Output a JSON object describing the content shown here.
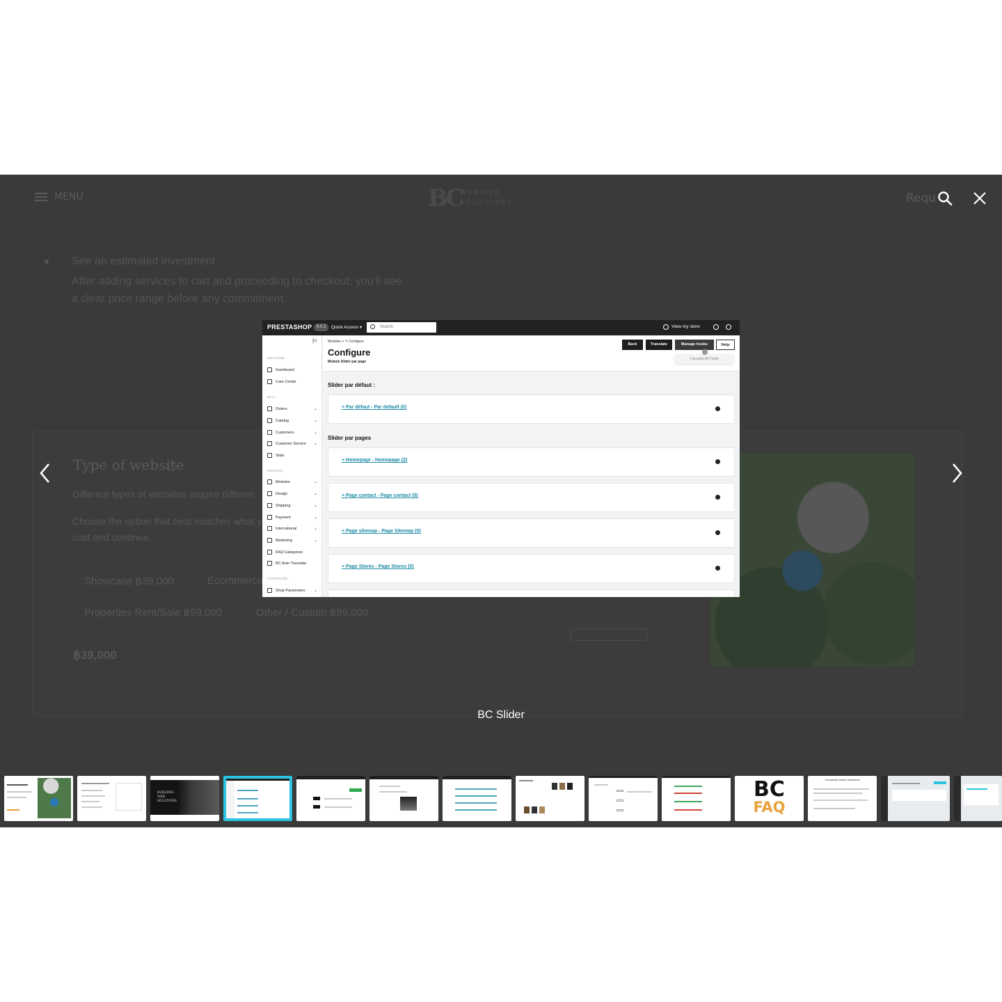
{
  "site_header": {
    "menu_label": "MENU",
    "logo_mark": "BC",
    "logo_text_line1": "WEBSITE",
    "logo_text_line2": "SOLUTIONS",
    "request_label": "Requ"
  },
  "background_page": {
    "bullet_title": "See an estimated investment",
    "bullet_body_line1": "After adding services to cart and proceeding to checkout, you'll see",
    "bullet_body_line2": "a clear price range before any commitment.",
    "type_title": "Type of website",
    "info_glyph": "i",
    "desc_line1": "Different types of websites require differen",
    "desc_line2": "Choose the option that best matches what y",
    "desc_line3": "cost and continue.",
    "options": [
      "Showcase ฿39,000",
      "Ecommerce",
      "Properties Rent/Sale ฿59,000",
      "Other / Custom ฿99,000"
    ],
    "total": "฿39,000"
  },
  "lightbox": {
    "caption": "BC Slider",
    "controls": {
      "search_icon": "search-icon",
      "close_icon": "close-icon",
      "prev_icon": "chevron-left-icon",
      "next_icon": "chevron-right-icon"
    },
    "accent_color": "#2bc3e0"
  },
  "screenshot": {
    "topbar": {
      "logo": "PRESTASHOP",
      "version": "9.0.2",
      "quick_access": "Quick Access  ▾",
      "search_placeholder": "Search",
      "view_store": "View my store"
    },
    "sidebar": {
      "collapse_glyph": "|<",
      "sections": {
        "welcome": "WELCOME",
        "sell": "SELL",
        "improve": "IMPROVE",
        "configure": "CONFIGURE"
      },
      "items": [
        "Dashboard",
        "Care Center",
        "Orders",
        "Catalog",
        "Customers",
        "Customer Service",
        "Stats",
        "Modules",
        "Design",
        "Shipping",
        "Payment",
        "International",
        "Marketing",
        "FAQ Categories",
        "BC Auto Translate",
        "Shop Parameters"
      ]
    },
    "header": {
      "breadcrumb": "Modules  >  ✎ Configure",
      "title": "Configure",
      "subtitle": "Module Slider par page",
      "buttons": {
        "back": "Back",
        "translate": "Translate",
        "manage_hooks": "Manage hooks",
        "help": "Help"
      },
      "dropdown_item": "Translate All Fields"
    },
    "section_default": "Slider par défaut :",
    "section_pages": "Slider par pages",
    "rows": [
      "≡ Par défaut - Par default (0)",
      "≡ Homepage - Homepage (2)",
      "≡ Page contact - Page contact (0)",
      "≡ Page sitemap - Page Sitemap (0)",
      "≡ Page Stores - Page Stores (0)"
    ]
  },
  "thumbnails": {
    "faq_logo_top": "BC",
    "faq_logo_bottom": "FAQ",
    "faq_logo_color": "#e8a33c",
    "building_text_1": "BUILDING",
    "building_text_2": "WEB",
    "building_text_3": "SOLUTIONS",
    "faq_page_title": "Frequently Asked Questions"
  }
}
